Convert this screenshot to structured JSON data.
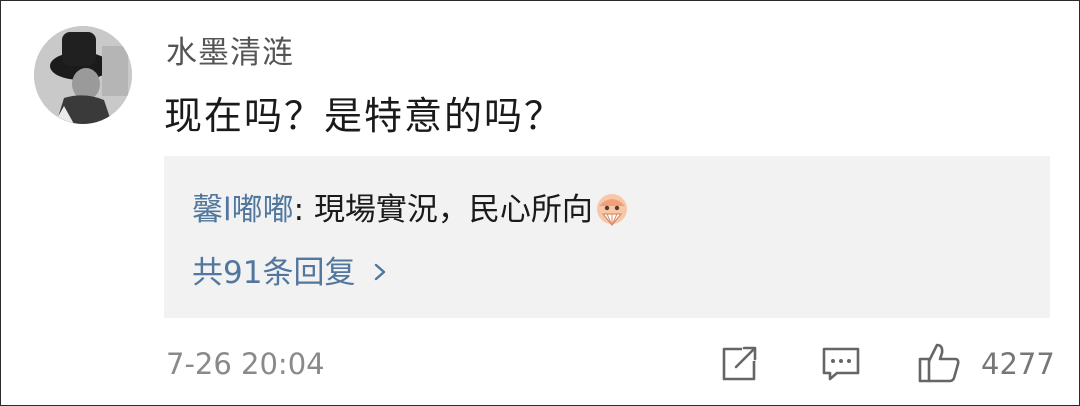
{
  "comment": {
    "username": "水墨清涟",
    "text": "现在吗？是特意的吗？",
    "timestamp": "7-26 20:04"
  },
  "reply_preview": {
    "author": "馨l嘟嘟",
    "separator": ": ",
    "text": "現場實況，民心所向",
    "emoji": "fan-emoji",
    "reply_count_label": "共91条回复"
  },
  "actions": {
    "share_icon": "share-icon",
    "comment_icon": "comment-icon",
    "like_icon": "thumbs-up-icon",
    "like_count": "4277"
  },
  "colors": {
    "link": "#52779f",
    "muted": "#8a8a8a",
    "text": "#1a1a1a",
    "reply_bg": "#f2f2f2"
  }
}
